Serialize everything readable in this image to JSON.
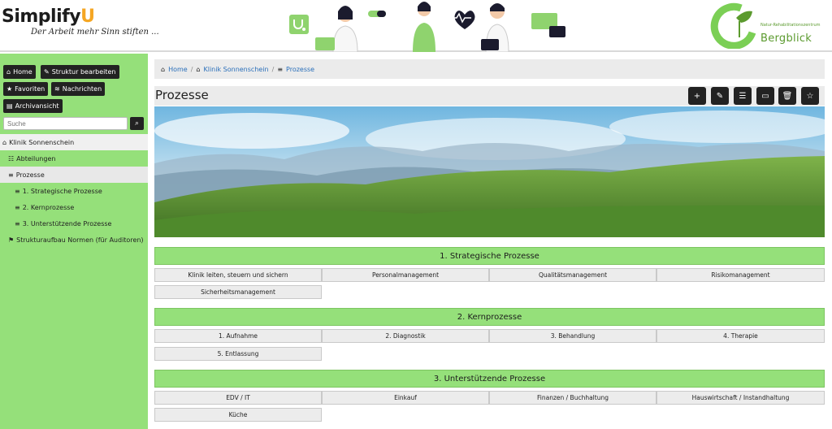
{
  "header": {
    "logo_word": "Simplify",
    "logo_u": "U",
    "logo_tagline": "Der Arbeit mehr Sinn stiften ...",
    "brand_subtitle": "Natur-Rehabilitationszentrum",
    "brand_name": "Bergblick"
  },
  "sidebar": {
    "buttons": {
      "home": "Home",
      "structure": "Struktur bearbeiten",
      "favorites": "Favoriten",
      "messages": "Nachrichten",
      "archive": "Archivansicht"
    },
    "search_placeholder": "Suche",
    "tree": [
      {
        "label": "Klinik Sonnenschein",
        "icon": "building-icon"
      },
      {
        "label": "Abteilungen",
        "icon": "group-icon"
      },
      {
        "label": "Prozesse",
        "icon": "layers-icon"
      },
      {
        "label": "1. Strategische Prozesse",
        "icon": "layers-icon"
      },
      {
        "label": "2. Kernprozesse",
        "icon": "layers-icon"
      },
      {
        "label": "3. Unterstützende Prozesse",
        "icon": "layers-icon"
      },
      {
        "label": "Strukturaufbau Normen (für Auditoren)",
        "icon": "flag-icon"
      }
    ]
  },
  "breadcrumb": {
    "home": "Home",
    "clinic": "Klinik Sonnenschein",
    "current": "Prozesse"
  },
  "page": {
    "title": "Prozesse",
    "tools": [
      "add-icon",
      "edit-icon",
      "checklist-icon",
      "archive-icon",
      "delete-icon",
      "star-icon"
    ]
  },
  "sections": [
    {
      "title": "1. Strategische Prozesse",
      "items": [
        "Klinik leiten, steuern und sichern",
        "Personalmanagement",
        "Qualitätsmanagement",
        "Risikomanagement",
        "Sicherheitsmanagement"
      ]
    },
    {
      "title": "2. Kernprozesse",
      "items": [
        "1. Aufnahme",
        "2. Diagnostik",
        "3. Behandlung",
        "4. Therapie",
        "5. Entlassung"
      ]
    },
    {
      "title": "3. Unterstützende Prozesse",
      "items": [
        "EDV / IT",
        "Einkauf",
        "Finanzen / Buchhaltung",
        "Hauswirtschaft / Instandhaltung",
        "Küche"
      ]
    }
  ],
  "colors": {
    "accent_green": "#95e07a",
    "dark_button": "#222222",
    "link_blue": "#2a6fba",
    "logo_orange": "#f5a623"
  }
}
